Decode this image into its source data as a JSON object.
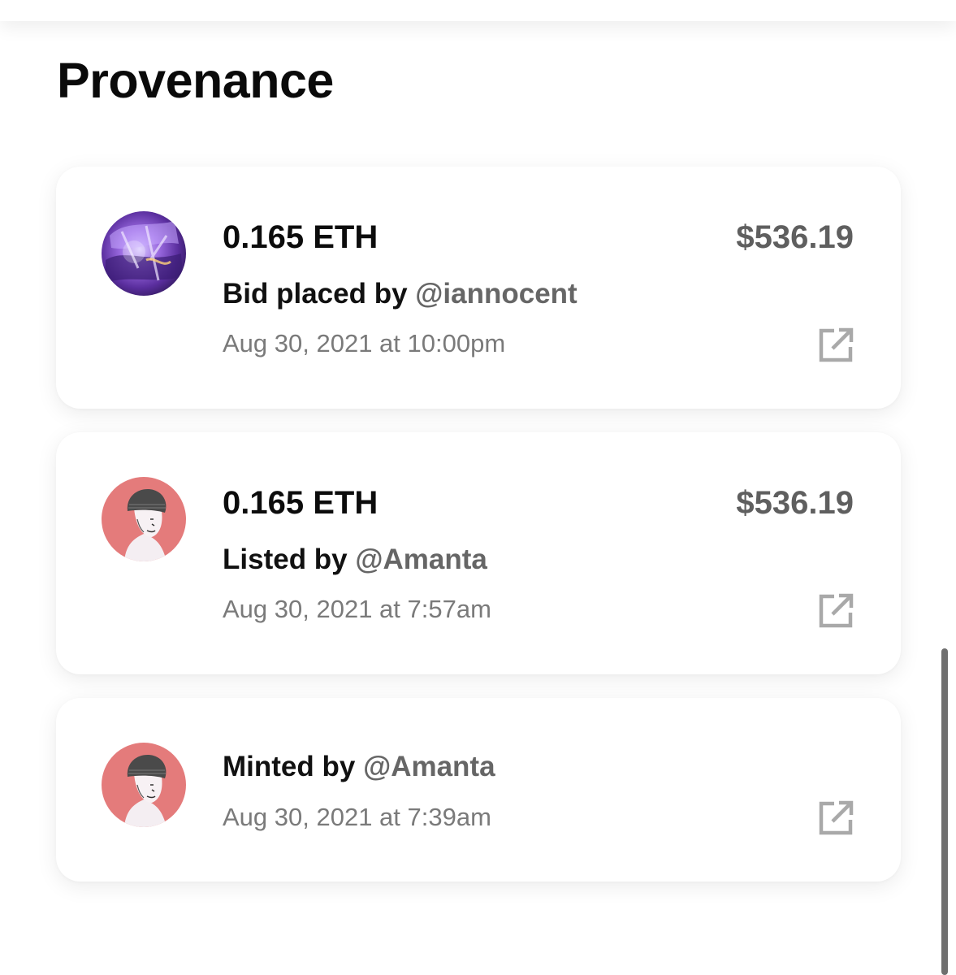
{
  "section_title": "Provenance",
  "colors": {
    "accent_gray": "#666666",
    "secondary_text": "#7a7a7a",
    "icon_gray": "#a9a9a9",
    "avatar_pink": "#e47b7b",
    "avatar_purple": "#6a3fb0"
  },
  "events": [
    {
      "amount": "0.165 ETH",
      "usd": "$536.19",
      "action_label": "Bid placed by ",
      "user": "@iannocent",
      "date": "Aug 30, 2021 at 10:00pm",
      "avatar": "purple-abstract-avatar",
      "icon": "external-link-icon"
    },
    {
      "amount": "0.165 ETH",
      "usd": "$536.19",
      "action_label": "Listed by ",
      "user": "@Amanta",
      "date": "Aug 30, 2021 at 7:57am",
      "avatar": "beanie-portrait-avatar",
      "icon": "external-link-icon"
    },
    {
      "action_label": "Minted by ",
      "user": "@Amanta",
      "date": "Aug 30, 2021 at 7:39am",
      "avatar": "beanie-portrait-avatar",
      "icon": "external-link-icon"
    }
  ]
}
